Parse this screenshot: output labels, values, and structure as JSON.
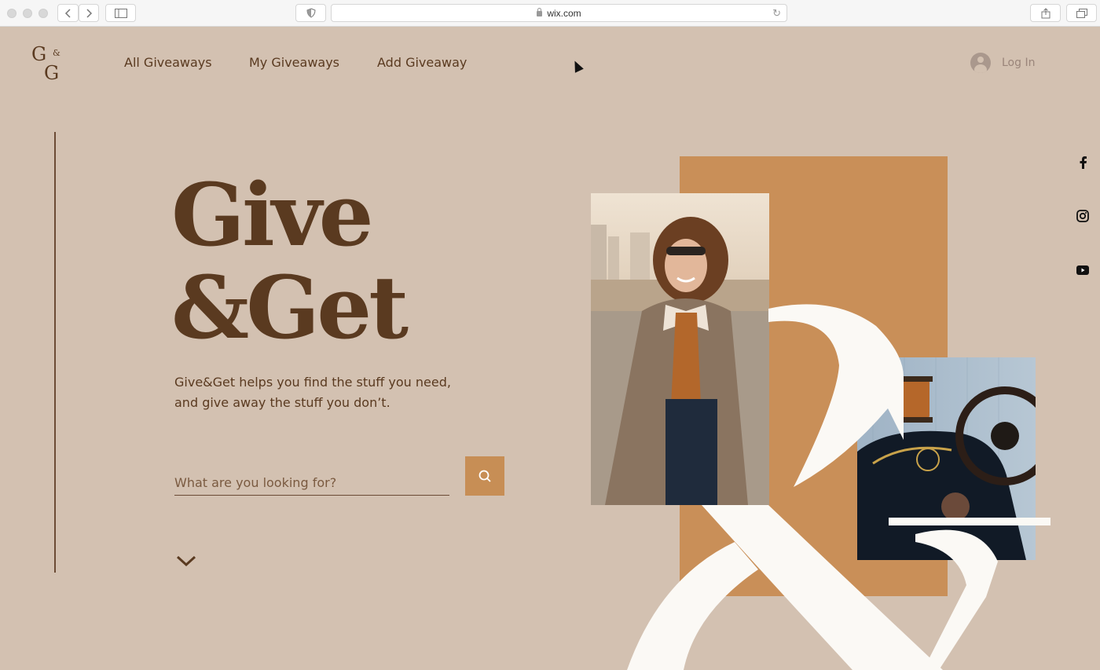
{
  "browser": {
    "url": "wix.com"
  },
  "header": {
    "logo": {
      "letter_top": "G",
      "ampersand": "&",
      "letter_bottom": "G"
    },
    "nav": [
      {
        "label": "All Giveaways"
      },
      {
        "label": "My Giveaways"
      },
      {
        "label": "Add Giveaway"
      }
    ],
    "login_label": "Log In"
  },
  "hero": {
    "title_line1": "Give",
    "title_line2": "&Get",
    "subtitle_line1": "Give&Get helps you find the stuff you need,",
    "subtitle_line2": "and give away the stuff you don’t.",
    "search_placeholder": "What are you looking for?"
  },
  "social": [
    {
      "icon": "facebook-icon"
    },
    {
      "icon": "instagram-icon"
    },
    {
      "icon": "youtube-icon"
    }
  ],
  "colors": {
    "background": "#d3c1b1",
    "brand_brown": "#5a3a20",
    "accent_orange": "#c78e55",
    "cream": "#fbf9f5"
  }
}
